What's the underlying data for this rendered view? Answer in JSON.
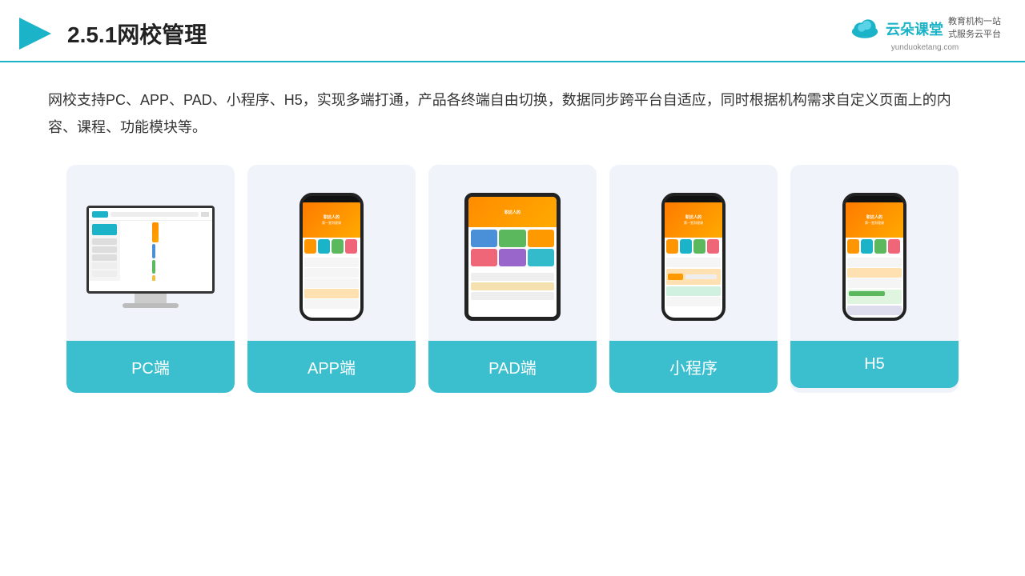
{
  "header": {
    "title": "2.5.1网校管理",
    "logo": {
      "name": "云朵课堂",
      "url": "yunduoketang.com",
      "subtitle_line1": "教育机构一站",
      "subtitle_line2": "式服务云平台"
    }
  },
  "description": "网校支持PC、APP、PAD、小程序、H5，实现多端打通，产品各终端自由切换，数据同步跨平台自适应，同时根据机构需求自定义页面上的内容、课程、功能模块等。",
  "cards": [
    {
      "id": "pc",
      "label": "PC端"
    },
    {
      "id": "app",
      "label": "APP端"
    },
    {
      "id": "pad",
      "label": "PAD端"
    },
    {
      "id": "miniprogram",
      "label": "小程序"
    },
    {
      "id": "h5",
      "label": "H5"
    }
  ],
  "colors": {
    "accent": "#1ab3c8",
    "card_bg": "#f0f4fa",
    "card_label_bg": "#3bbfcf",
    "header_border": "#1ab3c8"
  }
}
